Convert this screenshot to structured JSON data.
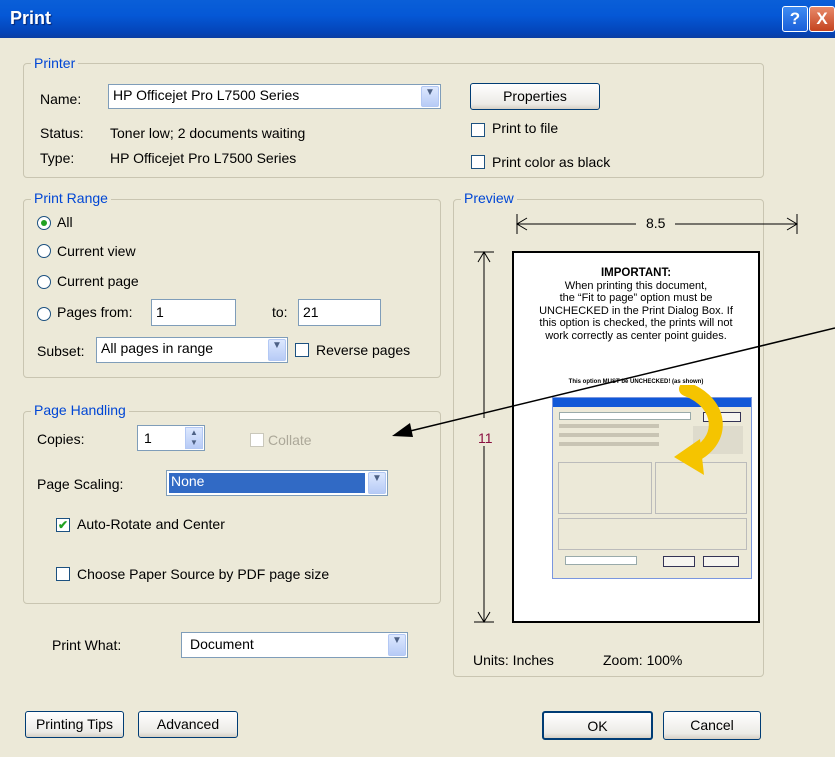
{
  "window": {
    "title": "Print",
    "help_glyph": "?",
    "close_glyph": "X"
  },
  "printer": {
    "group_label": "Printer",
    "name_label": "Name:",
    "name_value": "HP Officejet Pro L7500 Series",
    "status_label": "Status:",
    "status_value": "Toner low; 2 documents waiting",
    "type_label": "Type:",
    "type_value": "HP Officejet Pro L7500 Series",
    "properties_button": "Properties",
    "print_to_file": "Print to file",
    "print_color_as_black": "Print color as black"
  },
  "print_range": {
    "group_label": "Print Range",
    "all": "All",
    "current_view": "Current view",
    "current_page": "Current page",
    "pages_from": "Pages from:",
    "from_value": "1",
    "to_label": "to:",
    "to_value": "21",
    "subset_label": "Subset:",
    "subset_value": "All pages in range",
    "reverse_pages": "Reverse pages",
    "selected": "All"
  },
  "page_handling": {
    "group_label": "Page Handling",
    "copies_label": "Copies:",
    "copies_value": "1",
    "collate": "Collate",
    "page_scaling_label": "Page Scaling:",
    "page_scaling_value": "None",
    "auto_rotate": "Auto-Rotate and Center",
    "auto_rotate_checked": true,
    "choose_paper_source": "Choose Paper Source by PDF page size",
    "choose_paper_source_checked": false
  },
  "print_what": {
    "label": "Print What:",
    "value": "Document"
  },
  "preview": {
    "group_label": "Preview",
    "width_label": "8.5",
    "height_label": "11",
    "units": "Units: Inches",
    "zoom": "Zoom: 100%",
    "page_heading": "IMPORTANT:",
    "page_line1": "When printing this document,",
    "page_line2": "the “Fit to page” option must be",
    "page_line3": "UNCHECKED in the Print Dialog Box. If",
    "page_line4": "this option is checked, the prints will not",
    "page_line5": "work correctly as center point guides.",
    "page_caption": "This option MUST be UNCHECKED! (as shown)",
    "arrow_color": "#f5c400"
  },
  "footer": {
    "printing_tips": "Printing Tips",
    "advanced": "Advanced",
    "ok": "OK",
    "cancel": "Cancel"
  },
  "colors": {
    "title_bar": "#0558d6",
    "group_label": "#0046d5",
    "highlight": "#316ac5",
    "check": "#21a121",
    "height_dim": "#8a1040"
  }
}
